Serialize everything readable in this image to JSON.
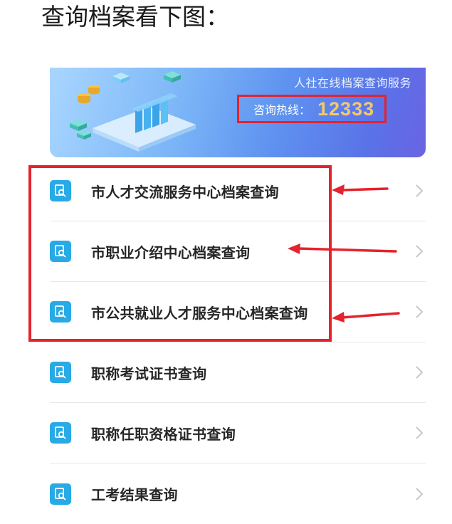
{
  "heading": "查询档案看下图：",
  "banner": {
    "title": "人社在线档案查询服务",
    "hotline_label": "咨询热线：",
    "hotline_number": "12333"
  },
  "menu": {
    "items": [
      {
        "label": "市人才交流服务中心档案查询"
      },
      {
        "label": "市职业介绍中心档案查询"
      },
      {
        "label": "市公共就业人才服务中心档案查询"
      },
      {
        "label": "职称考试证书查询"
      },
      {
        "label": "职称任职资格证书查询"
      },
      {
        "label": "工考结果查询"
      }
    ]
  },
  "colors": {
    "highlight": "#e3232d",
    "icon_bg": "#27aae6",
    "hotline_number": "#f3c96a"
  },
  "icons": {
    "menu_item": "document-search-icon",
    "chevron": "chevron-right-icon"
  }
}
